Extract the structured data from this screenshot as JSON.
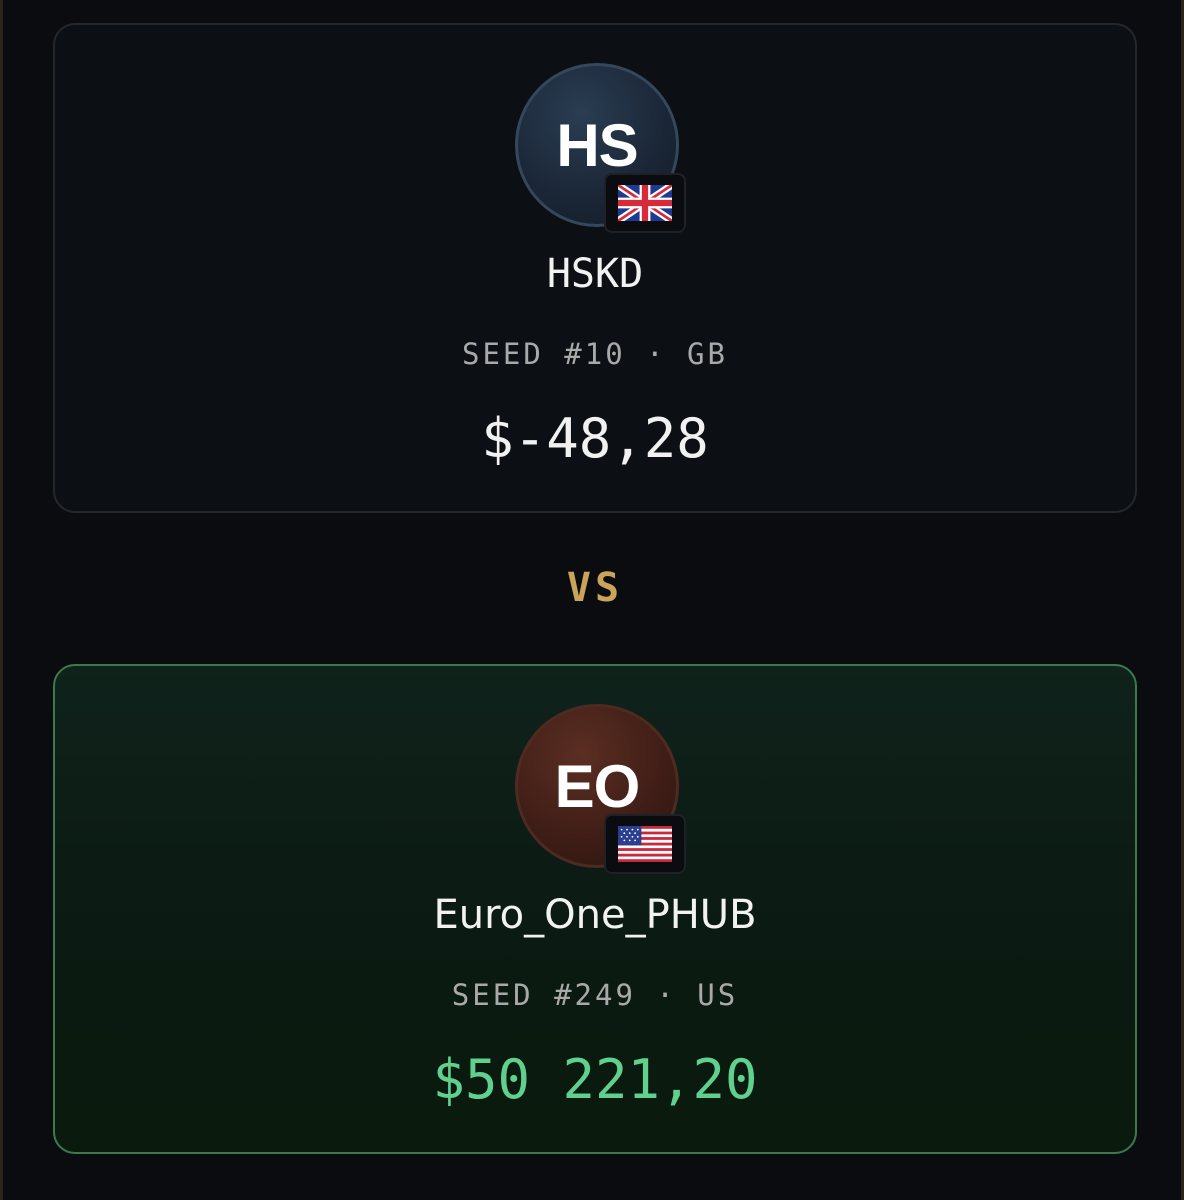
{
  "colors": {
    "background": "#0a0c0f",
    "vs_accent": "#c9a55a",
    "winner_border": "#3c7a4e",
    "winner_amount": "#5fd08e"
  },
  "players": [
    {
      "initials": "HS",
      "flag_icon": "gb-flag-icon",
      "name": "HSKD",
      "meta": "SEED #10 · GB",
      "amount": "$-48,28"
    },
    {
      "initials": "EO",
      "flag_icon": "us-flag-icon",
      "name": "Euro_One_PHUB",
      "meta": "SEED #249 · US",
      "amount": "$50 221,20"
    }
  ],
  "vs_label": "VS"
}
